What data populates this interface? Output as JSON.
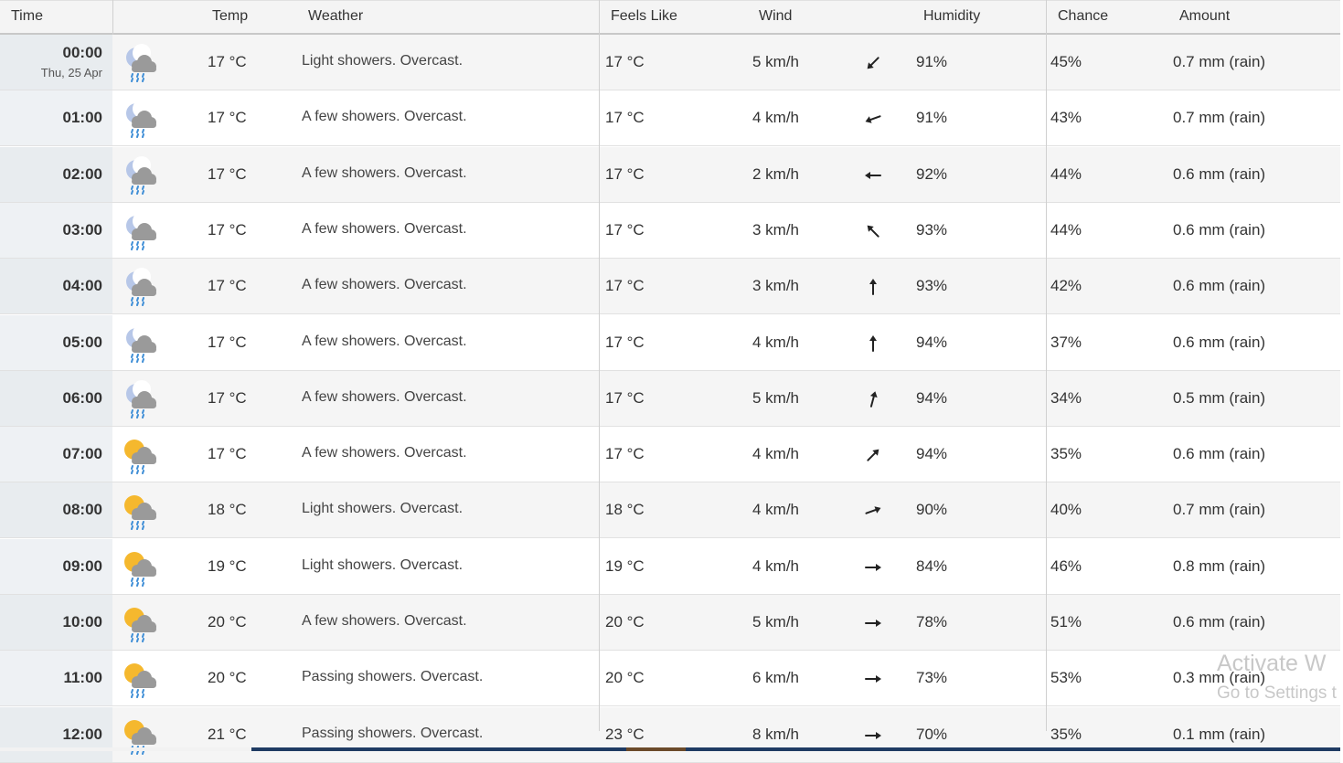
{
  "header": {
    "time": "Time",
    "temp": "Temp",
    "weather": "Weather",
    "feels_like": "Feels Like",
    "wind": "Wind",
    "humidity": "Humidity",
    "chance": "Chance",
    "amount": "Amount"
  },
  "rows": [
    {
      "time": "00:00",
      "date": "Thu, 25 Apr",
      "icon": "moon-cloud-rain-icon",
      "temp": "17 °C",
      "weather": "Light showers. Overcast.",
      "feels": "17 °C",
      "wind": "5 km/h",
      "wind_dir": "south-west-arrow-icon",
      "humidity": "91%",
      "chance": "45%",
      "amount": "0.7 mm (rain)"
    },
    {
      "time": "01:00",
      "date": "",
      "icon": "moon-cloud-rain-icon",
      "temp": "17 °C",
      "weather": "A few showers. Overcast.",
      "feels": "17 °C",
      "wind": "4 km/h",
      "wind_dir": "west-south-west-arrow-icon",
      "humidity": "91%",
      "chance": "43%",
      "amount": "0.7 mm (rain)"
    },
    {
      "time": "02:00",
      "date": "",
      "icon": "moon-cloud-rain-icon",
      "temp": "17 °C",
      "weather": "A few showers. Overcast.",
      "feels": "17 °C",
      "wind": "2 km/h",
      "wind_dir": "west-arrow-icon",
      "humidity": "92%",
      "chance": "44%",
      "amount": "0.6 mm (rain)"
    },
    {
      "time": "03:00",
      "date": "",
      "icon": "moon-cloud-rain-icon",
      "temp": "17 °C",
      "weather": "A few showers. Overcast.",
      "feels": "17 °C",
      "wind": "3 km/h",
      "wind_dir": "north-west-arrow-icon",
      "humidity": "93%",
      "chance": "44%",
      "amount": "0.6 mm (rain)"
    },
    {
      "time": "04:00",
      "date": "",
      "icon": "moon-cloud-rain-icon",
      "temp": "17 °C",
      "weather": "A few showers. Overcast.",
      "feels": "17 °C",
      "wind": "3 km/h",
      "wind_dir": "north-arrow-icon",
      "humidity": "93%",
      "chance": "42%",
      "amount": "0.6 mm (rain)"
    },
    {
      "time": "05:00",
      "date": "",
      "icon": "moon-cloud-rain-icon",
      "temp": "17 °C",
      "weather": "A few showers. Overcast.",
      "feels": "17 °C",
      "wind": "4 km/h",
      "wind_dir": "north-arrow-icon",
      "humidity": "94%",
      "chance": "37%",
      "amount": "0.6 mm (rain)"
    },
    {
      "time": "06:00",
      "date": "",
      "icon": "moon-cloud-rain-icon",
      "temp": "17 °C",
      "weather": "A few showers. Overcast.",
      "feels": "17 °C",
      "wind": "5 km/h",
      "wind_dir": "north-north-east-arrow-icon",
      "humidity": "94%",
      "chance": "34%",
      "amount": "0.5 mm (rain)"
    },
    {
      "time": "07:00",
      "date": "",
      "icon": "sun-cloud-rain-icon",
      "temp": "17 °C",
      "weather": "A few showers. Overcast.",
      "feels": "17 °C",
      "wind": "4 km/h",
      "wind_dir": "north-east-arrow-icon",
      "humidity": "94%",
      "chance": "35%",
      "amount": "0.6 mm (rain)"
    },
    {
      "time": "08:00",
      "date": "",
      "icon": "sun-cloud-rain-icon",
      "temp": "18 °C",
      "weather": "Light showers. Overcast.",
      "feels": "18 °C",
      "wind": "4 km/h",
      "wind_dir": "east-north-east-arrow-icon",
      "humidity": "90%",
      "chance": "40%",
      "amount": "0.7 mm (rain)"
    },
    {
      "time": "09:00",
      "date": "",
      "icon": "sun-cloud-rain-icon",
      "temp": "19 °C",
      "weather": "Light showers. Overcast.",
      "feels": "19 °C",
      "wind": "4 km/h",
      "wind_dir": "east-arrow-icon",
      "humidity": "84%",
      "chance": "46%",
      "amount": "0.8 mm (rain)"
    },
    {
      "time": "10:00",
      "date": "",
      "icon": "sun-cloud-rain-icon",
      "temp": "20 °C",
      "weather": "A few showers. Overcast.",
      "feels": "20 °C",
      "wind": "5 km/h",
      "wind_dir": "east-arrow-icon",
      "humidity": "78%",
      "chance": "51%",
      "amount": "0.6 mm (rain)"
    },
    {
      "time": "11:00",
      "date": "",
      "icon": "sun-cloud-rain-icon",
      "temp": "20 °C",
      "weather": "Passing showers. Overcast.",
      "feels": "20 °C",
      "wind": "6 km/h",
      "wind_dir": "east-arrow-icon",
      "humidity": "73%",
      "chance": "53%",
      "amount": "0.3 mm (rain)"
    },
    {
      "time": "12:00",
      "date": "",
      "icon": "sun-cloud-rain-icon",
      "temp": "21 °C",
      "weather": "Passing showers. Overcast.",
      "feels": "23 °C",
      "wind": "8 km/h",
      "wind_dir": "east-arrow-icon",
      "humidity": "70%",
      "chance": "35%",
      "amount": "0.1 mm (rain)"
    }
  ],
  "wind_angles": [
    225,
    250,
    270,
    315,
    0,
    0,
    15,
    45,
    70,
    90,
    90,
    90,
    90
  ],
  "watermark": {
    "line1": "Activate W",
    "line2": "Go to Settings t"
  },
  "colors": {
    "header_bg": "#f4f4f4",
    "row_alt_bg": "#f5f5f5",
    "time_col_bg": "#e8ecef",
    "sun": "#f5b82e",
    "moon": "#b7c7e8",
    "cloud": "#9a9a9a",
    "rain": "#3f8ed6"
  }
}
